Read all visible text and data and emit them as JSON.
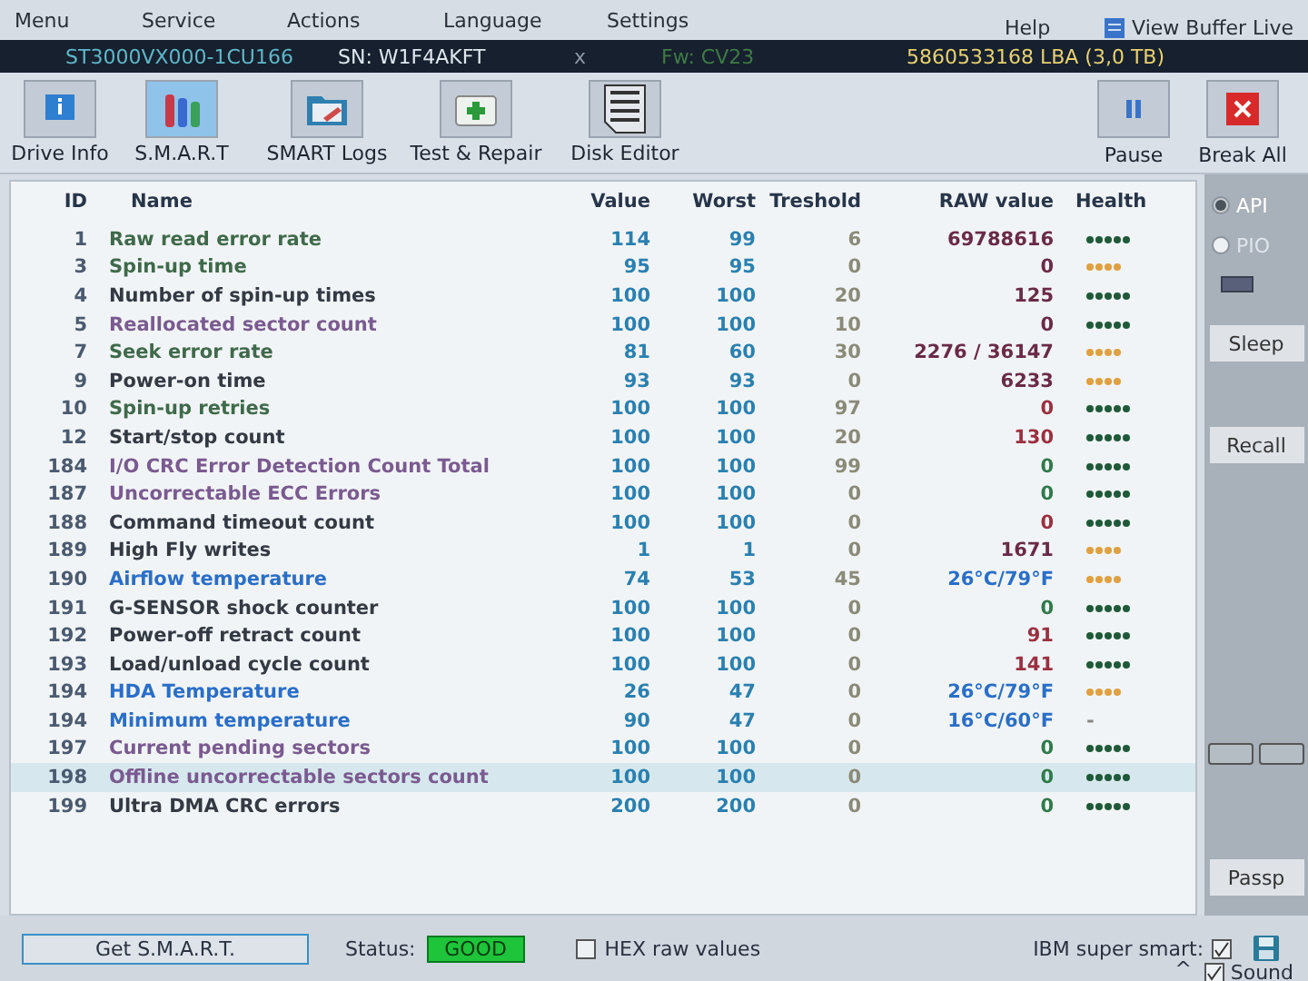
{
  "menu": [
    "Menu",
    "Service",
    "Actions",
    "Language",
    "Settings",
    "Help"
  ],
  "view_buffer": {
    "label": "View Buffer Live"
  },
  "drive_bar": {
    "model": "ST3000VX000-1CU166",
    "serial": "SN: W1F4AKFT",
    "close": "x",
    "firmware": "Fw: CV23",
    "capacity": "5860533168 LBA (3,0 TB)"
  },
  "toolbar": [
    {
      "label": "Drive Info",
      "selected": false
    },
    {
      "label": "S.M.A.R.T",
      "selected": true
    },
    {
      "label": "SMART Logs",
      "selected": false
    },
    {
      "label": "Test & Repair",
      "selected": false
    },
    {
      "label": "Disk Editor",
      "selected": false
    }
  ],
  "actions": [
    {
      "label": "Pause",
      "kind": "pause"
    },
    {
      "label": "Break All",
      "kind": "stop"
    }
  ],
  "table": {
    "columns": [
      "ID",
      "Name",
      "Value",
      "Worst",
      "Treshold",
      "RAW value",
      "Health"
    ],
    "rows": [
      {
        "id": "1",
        "name": "Raw read error rate",
        "color": "#3f6a4a",
        "value": "114",
        "worst": "99",
        "threshold": "6",
        "raw": {
          "text": "69788616",
          "color": "#6a2a48"
        },
        "stars": 5,
        "selected": false
      },
      {
        "id": "3",
        "name": "Spin-up time",
        "color": "#3f6a4a",
        "value": "95",
        "worst": "95",
        "threshold": "0",
        "raw": {
          "text": "0",
          "color": "#6a2a48"
        },
        "stars": 4,
        "selected": false
      },
      {
        "id": "4",
        "name": "Number of spin-up times",
        "color": "#333a44",
        "value": "100",
        "worst": "100",
        "threshold": "20",
        "raw": {
          "text": "125",
          "color": "#6a2a48"
        },
        "stars": 5,
        "selected": false
      },
      {
        "id": "5",
        "name": "Reallocated sector count",
        "color": "#7a5a90",
        "value": "100",
        "worst": "100",
        "threshold": "10",
        "raw": {
          "text": "0",
          "color": "#6a2a48"
        },
        "stars": 5,
        "selected": false
      },
      {
        "id": "7",
        "name": "Seek error rate",
        "color": "#3f6a4a",
        "value": "81",
        "worst": "60",
        "threshold": "30",
        "raw": {
          "text": "2276 / 36147",
          "color": "#6a2a48"
        },
        "stars": 4,
        "selected": false
      },
      {
        "id": "9",
        "name": "Power-on time",
        "color": "#333a44",
        "value": "93",
        "worst": "93",
        "threshold": "0",
        "raw": {
          "text": "6233",
          "color": "#6a2a48"
        },
        "stars": 4,
        "selected": false
      },
      {
        "id": "10",
        "name": "Spin-up retries",
        "color": "#3f6a4a",
        "value": "100",
        "worst": "100",
        "threshold": "97",
        "raw": {
          "text": "0",
          "color": "#9a3040"
        },
        "stars": 5,
        "selected": false
      },
      {
        "id": "12",
        "name": "Start/stop count",
        "color": "#333a44",
        "value": "100",
        "worst": "100",
        "threshold": "20",
        "raw": {
          "text": "130",
          "color": "#9a3040"
        },
        "stars": 5,
        "selected": false
      },
      {
        "id": "184",
        "name": "I/O CRC Error Detection Count Total",
        "color": "#7a5a90",
        "value": "100",
        "worst": "100",
        "threshold": "99",
        "raw": {
          "text": "0",
          "color": "#2f7a4a"
        },
        "stars": 5,
        "selected": false
      },
      {
        "id": "187",
        "name": "Uncorrectable ECC Errors",
        "color": "#7a5a90",
        "value": "100",
        "worst": "100",
        "threshold": "0",
        "raw": {
          "text": "0",
          "color": "#2f7a4a"
        },
        "stars": 5,
        "selected": false
      },
      {
        "id": "188",
        "name": "Command timeout count",
        "color": "#333a44",
        "value": "100",
        "worst": "100",
        "threshold": "0",
        "raw": {
          "text": "0",
          "color": "#9a3040"
        },
        "stars": 5,
        "selected": false
      },
      {
        "id": "189",
        "name": "High Fly writes",
        "color": "#333a44",
        "value": "1",
        "worst": "1",
        "threshold": "0",
        "raw": {
          "text": "1671",
          "color": "#6a2a48"
        },
        "stars": 4,
        "selected": false
      },
      {
        "id": "190",
        "name": "Airflow temperature",
        "color": "#2a6ec8",
        "value": "74",
        "worst": "53",
        "threshold": "45",
        "raw": {
          "text": "26°C/79°F",
          "color": "#2a6ec8"
        },
        "stars": 4,
        "selected": false
      },
      {
        "id": "191",
        "name": "G-SENSOR shock counter",
        "color": "#333a44",
        "value": "100",
        "worst": "100",
        "threshold": "0",
        "raw": {
          "text": "0",
          "color": "#2f7a4a"
        },
        "stars": 5,
        "selected": false
      },
      {
        "id": "192",
        "name": "Power-off retract count",
        "color": "#333a44",
        "value": "100",
        "worst": "100",
        "threshold": "0",
        "raw": {
          "text": "91",
          "color": "#9a3040"
        },
        "stars": 5,
        "selected": false
      },
      {
        "id": "193",
        "name": "Load/unload cycle count",
        "color": "#333a44",
        "value": "100",
        "worst": "100",
        "threshold": "0",
        "raw": {
          "text": "141",
          "color": "#9a3040"
        },
        "stars": 5,
        "selected": false
      },
      {
        "id": "194",
        "name": "HDA Temperature",
        "color": "#2a6ec8",
        "value": "26",
        "worst": "47",
        "threshold": "0",
        "raw": {
          "text": "26°C/79°F",
          "color": "#2a6ec8"
        },
        "stars": 4,
        "selected": false
      },
      {
        "id": "194",
        "name": "Minimum temperature",
        "color": "#2a6ec8",
        "value": "90",
        "worst": "47",
        "threshold": "0",
        "raw": {
          "text": "16°C/60°F",
          "color": "#2a6ec8"
        },
        "health_text": "-",
        "selected": false
      },
      {
        "id": "197",
        "name": "Current pending sectors",
        "color": "#7a5a90",
        "value": "100",
        "worst": "100",
        "threshold": "0",
        "raw": {
          "text": "0",
          "color": "#2f7a4a"
        },
        "stars": 5,
        "selected": false
      },
      {
        "id": "198",
        "name": "Offline uncorrectable sectors count",
        "color": "#7a5a90",
        "value": "100",
        "worst": "100",
        "threshold": "0",
        "raw": {
          "text": "0",
          "color": "#2f7a4a"
        },
        "stars": 5,
        "selected": true
      },
      {
        "id": "199",
        "name": "Ultra DMA CRC errors",
        "color": "#333a44",
        "value": "200",
        "worst": "200",
        "threshold": "0",
        "raw": {
          "text": "0",
          "color": "#2f7a4a"
        },
        "stars": 5,
        "selected": false
      }
    ]
  },
  "side": {
    "modes": [
      {
        "label": "API",
        "selected": true
      },
      {
        "label": "PIO",
        "selected": false
      }
    ],
    "buttons": [
      "Sleep",
      "Recall"
    ],
    "passp": "Passp"
  },
  "status_bar": {
    "get_button": "Get S.M.A.R.T.",
    "status_label": "Status:",
    "status": "GOOD",
    "hex": {
      "label": "HEX raw values",
      "checked": false
    },
    "ibm": {
      "label": "IBM super smart:",
      "checked": true
    },
    "caret": "^",
    "sound": {
      "label": "Sound",
      "checked": true
    }
  }
}
